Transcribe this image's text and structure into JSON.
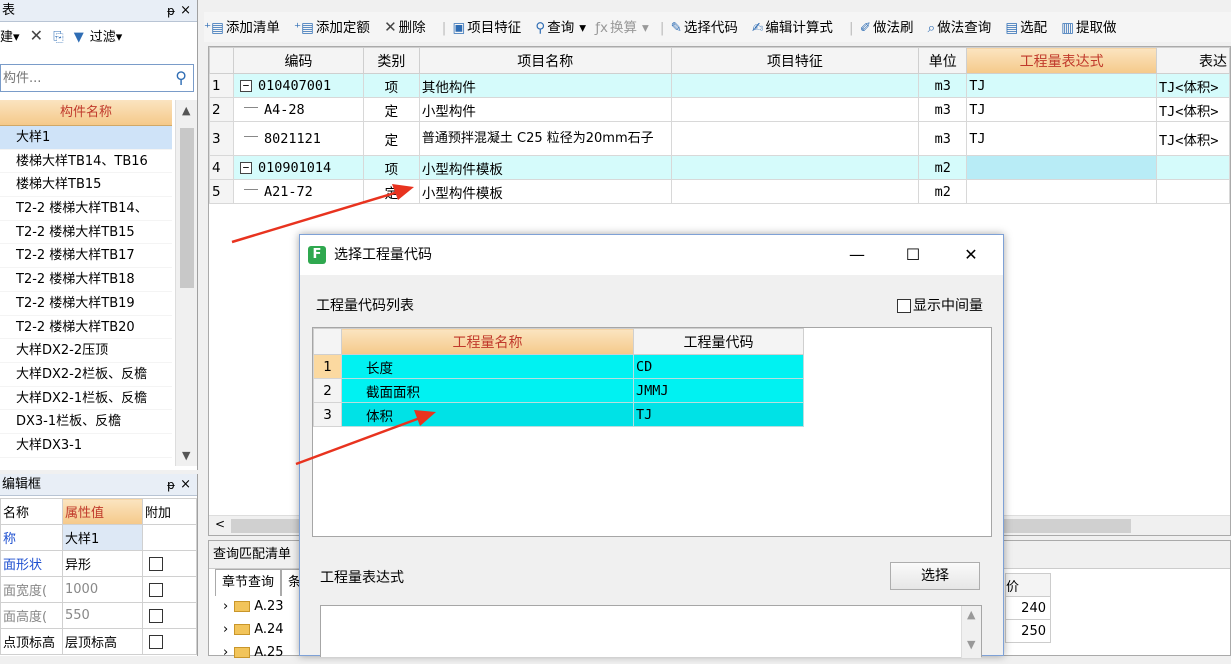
{
  "left_panel": {
    "title": "表",
    "pin": "ᵽ",
    "close": "×",
    "toolbar": {
      "new_label": "建▾",
      "delete_icon": "✕",
      "copy_icon": "⎘",
      "filter_label": "过滤▾"
    },
    "search_placeholder": "构件...",
    "column_header": "构件名称",
    "items": [
      "大样1",
      "楼梯大样TB14、TB16",
      "楼梯大样TB15",
      "T2-2  楼梯大样TB14、",
      "T2-2  楼梯大样TB15",
      "T2-2  楼梯大样TB17",
      "T2-2  楼梯大样TB18",
      "T2-2  楼梯大样TB19",
      "T2-2  楼梯大样TB20",
      "大样DX2-2压顶",
      "大样DX2-2栏板、反檐",
      "大样DX2-1栏板、反檐",
      "DX3-1栏板、反檐",
      "大样DX3-1"
    ]
  },
  "prop_panel": {
    "title": "编辑框",
    "pin": "ᵽ",
    "close": "×",
    "headers": [
      "名称",
      "属性值",
      "附加"
    ],
    "rows": [
      {
        "name": "称",
        "value": "大样1"
      },
      {
        "name": "面形状",
        "value": "异形"
      },
      {
        "name": "面宽度(",
        "value": "1000"
      },
      {
        "name": "面高度(",
        "value": "550"
      },
      {
        "name": "点顶标高",
        "value": "层顶标高"
      }
    ]
  },
  "toolbar": {
    "add_list": "添加清单",
    "add_quota": "添加定额",
    "delete": "删除",
    "item_feature": "项目特征",
    "query": "查询",
    "convert": "换算",
    "select_code": "选择代码",
    "edit_formula": "编辑计算式",
    "method_brush": "做法刷",
    "method_query": "做法查询",
    "select_match": "选配",
    "extract": "提取做"
  },
  "grid": {
    "headers": [
      "编码",
      "类别",
      "项目名称",
      "项目特征",
      "单位",
      "工程量表达式",
      "表达"
    ],
    "rows": [
      {
        "idx": "1",
        "code": "010407001",
        "type": "项",
        "name": "其他构件",
        "feature": "",
        "unit": "m3",
        "expr": "TJ",
        "expr2": "TJ<体积>"
      },
      {
        "idx": "2",
        "code": "A4-28",
        "type": "定",
        "name": "小型构件",
        "feature": "",
        "unit": "m3",
        "expr": "TJ",
        "expr2": "TJ<体积>"
      },
      {
        "idx": "3",
        "code": "8021121",
        "type": "定",
        "name": "普通预拌混凝土 C25 粒径为20mm石子",
        "feature": "",
        "unit": "m3",
        "expr": "TJ",
        "expr2": "TJ<体积>"
      },
      {
        "idx": "4",
        "code": "010901014",
        "type": "项",
        "name": "小型构件模板",
        "feature": "",
        "unit": "m2",
        "expr": "",
        "expr2": ""
      },
      {
        "idx": "5",
        "code": "A21-72",
        "type": "定",
        "name": "小型构件模板",
        "feature": "",
        "unit": "m2",
        "expr": "",
        "expr2": ""
      }
    ]
  },
  "query_panel": {
    "title": "查询匹配清单",
    "tab_chapter": "章节查询",
    "tab_other": "条",
    "tree": [
      "A.23",
      "A.24",
      "A.25"
    ],
    "price_header": "价",
    "prices": [
      "240",
      "250"
    ]
  },
  "dialog": {
    "title": "选择工程量代码",
    "app_icon": "F",
    "minimize": "—",
    "maximize": "☐",
    "close": "✕",
    "list_label": "工程量代码列表",
    "show_mid_label": "显示中间量",
    "headers": [
      "工程量名称",
      "工程量代码"
    ],
    "rows": [
      {
        "idx": "1",
        "name": "长度",
        "code": "CD"
      },
      {
        "idx": "2",
        "name": "截面面积",
        "code": "JMMJ"
      },
      {
        "idx": "3",
        "name": "体积",
        "code": "TJ"
      }
    ],
    "expr_label": "工程量表达式",
    "select_button": "选择"
  },
  "colors": {
    "highlight_header": "#f5c98a",
    "row_cyan": "#d5fbfb",
    "dialog_cell": "#00f2f2",
    "annotation_arrow": "#e8331f"
  }
}
